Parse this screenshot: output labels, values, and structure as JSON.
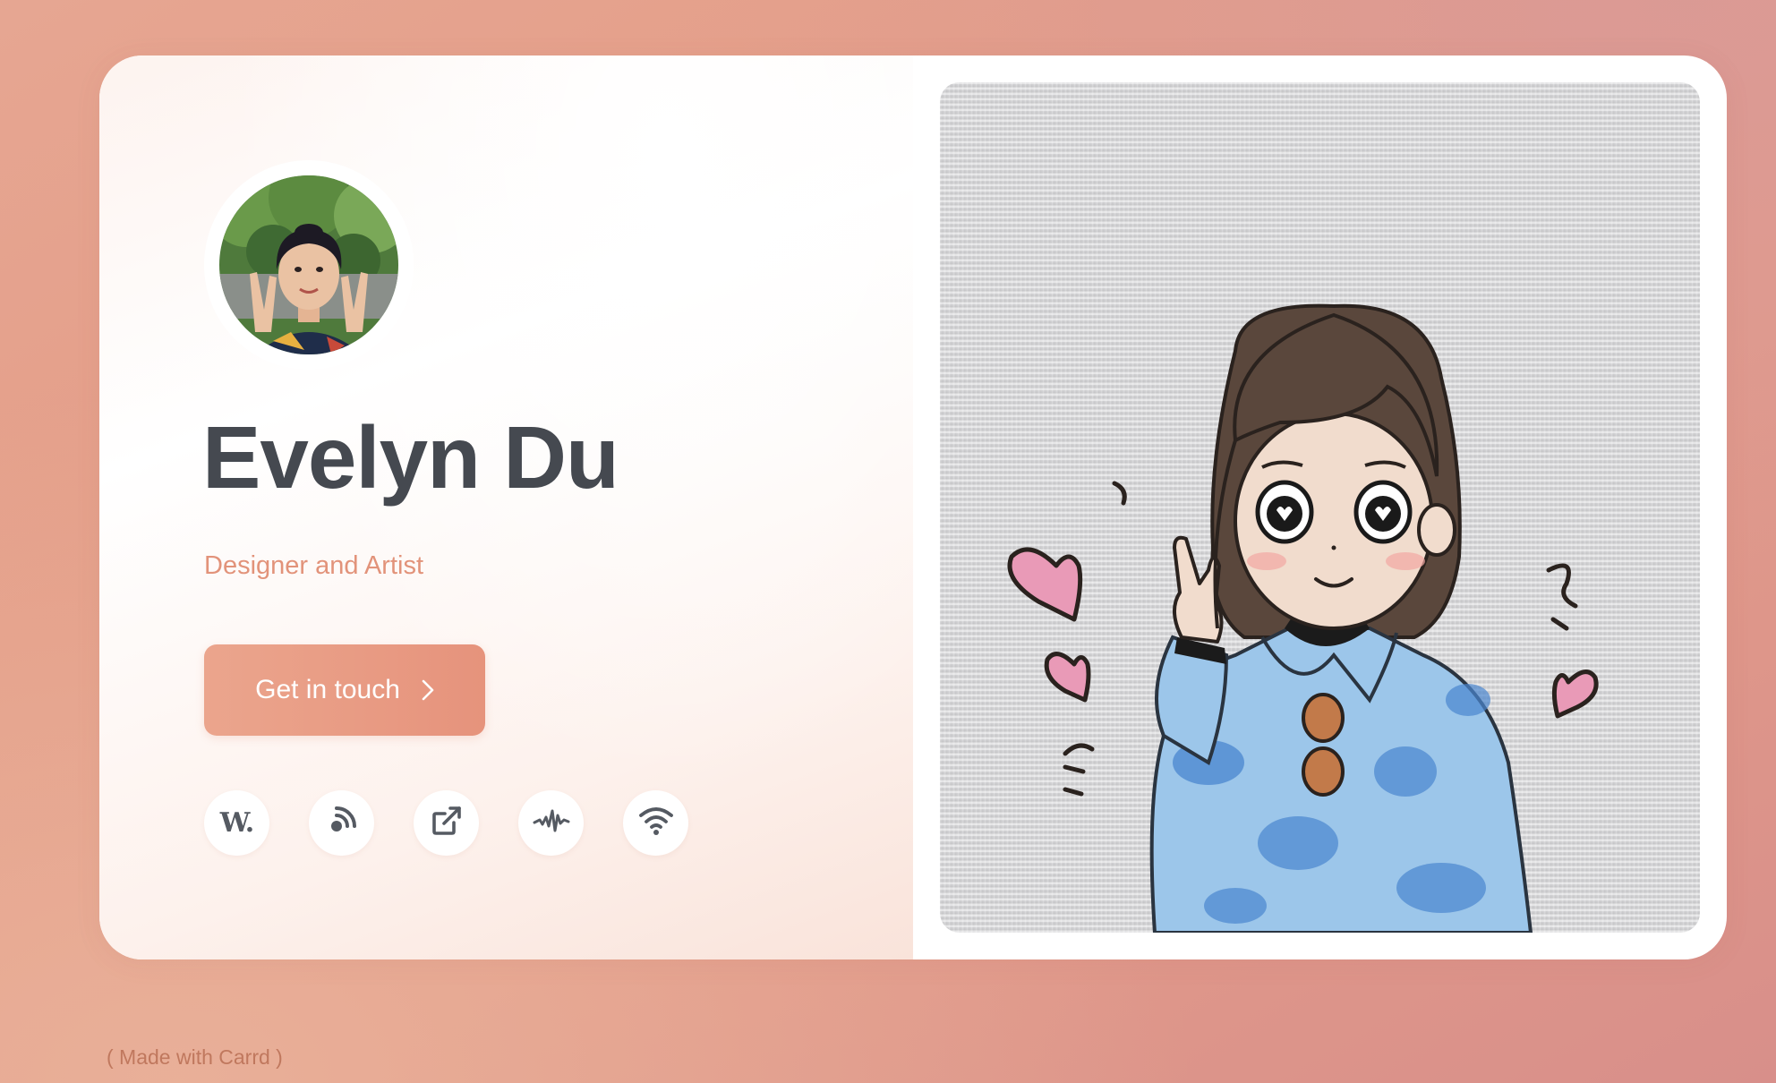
{
  "profile": {
    "name": "Evelyn Du",
    "tagline": "Designer and Artist"
  },
  "cta": {
    "label": "Get in touch",
    "icon": "chevron-right-icon"
  },
  "social_links": [
    {
      "icon": "w-letter-icon",
      "text": "W."
    },
    {
      "icon": "podcast-icon"
    },
    {
      "icon": "external-link-icon"
    },
    {
      "icon": "audio-wave-icon"
    },
    {
      "icon": "wifi-icon"
    }
  ],
  "footer": {
    "text": "( Made with Carrd )"
  },
  "colors": {
    "accent": "#e6937c",
    "name_text": "#454950",
    "background": "#e49e89"
  }
}
